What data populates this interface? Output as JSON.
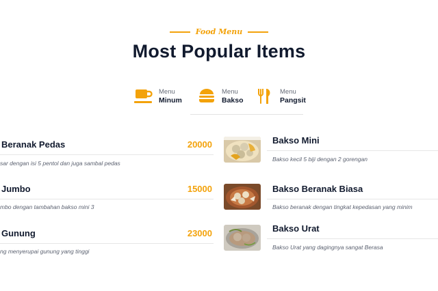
{
  "header": {
    "eyebrow": "Food Menu",
    "title": "Most Popular Items"
  },
  "tabs": [
    {
      "small": "Menu",
      "label": "Minum",
      "icon": "cup-icon"
    },
    {
      "small": "Menu",
      "label": "Bakso",
      "icon": "burger-icon"
    },
    {
      "small": "Menu",
      "label": "Pangsit",
      "icon": "fork-knife-icon"
    }
  ],
  "left_items": [
    {
      "name": "Beranak Pedas",
      "price": "20000",
      "desc": "sar dengan isi 5 pentol dan juga sambal pedas"
    },
    {
      "name": "Jumbo",
      "price": "15000",
      "desc": "mbo dengan tambahan bakso mini 3"
    },
    {
      "name": "Gunung",
      "price": "23000",
      "desc": "ng menyerupai gunung yang tinggi"
    }
  ],
  "right_items": [
    {
      "name": "Bakso Mini",
      "desc": "Bakso kecil 5 biji dengan 2 gorengan",
      "image": "bakso-mini-photo"
    },
    {
      "name": "Bakso Beranak Biasa",
      "desc": "Bakso beranak dengan tingkat kepedasan yang minim",
      "image": "bakso-beranak-photo"
    },
    {
      "name": "Bakso Urat",
      "desc": "Bakso Urat yang dagingnya sangat Berasa",
      "image": "bakso-urat-photo"
    }
  ],
  "colors": {
    "accent": "#f3a20a",
    "heading": "#111a2e"
  }
}
